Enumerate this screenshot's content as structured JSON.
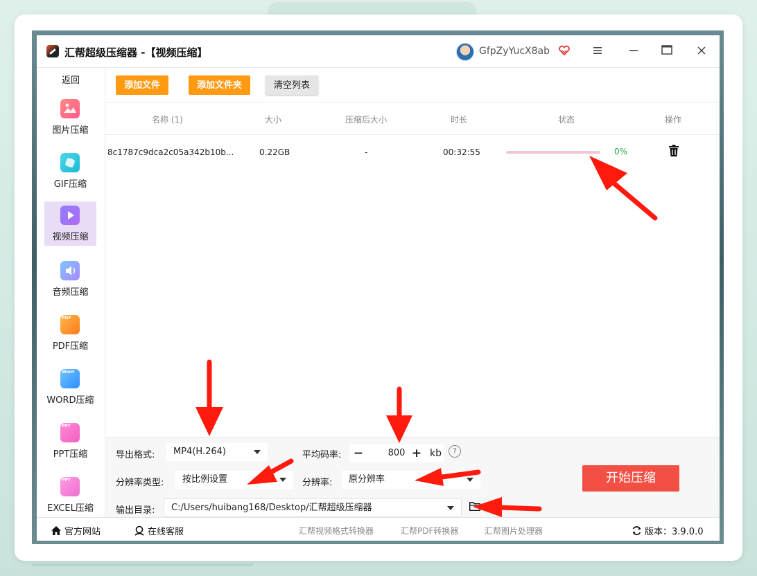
{
  "app": {
    "title": "汇帮超级压缩器  -【视频压缩】",
    "username": "GfpZyYucX8ab"
  },
  "sidebar": {
    "back": "返回",
    "items": [
      {
        "label": "图片压缩",
        "icon": "image-icon"
      },
      {
        "label": "GIF压缩",
        "icon": "gif-icon"
      },
      {
        "label": "视频压缩",
        "icon": "video-icon",
        "active": true
      },
      {
        "label": "音频压缩",
        "icon": "audio-icon"
      },
      {
        "label": "PDF压缩",
        "icon": "pdf-icon",
        "tag": "PDF"
      },
      {
        "label": "WORD压缩",
        "icon": "word-icon",
        "tag": "Word"
      },
      {
        "label": "PPT压缩",
        "icon": "ppt-icon",
        "tag": "PPT"
      },
      {
        "label": "EXCEL压缩",
        "icon": "excel-icon",
        "tag": "PPT"
      }
    ]
  },
  "toolbar": {
    "add_file": "添加文件",
    "add_folder": "添加文件夹",
    "clear_list": "清空列表"
  },
  "table": {
    "headers": {
      "name": "名称 (1)",
      "size": "大小",
      "compressed_size": "压缩后大小",
      "duration": "时长",
      "status": "状态",
      "action": "操作"
    },
    "rows": [
      {
        "name": "8c1787c9dca2c05a342b10b...",
        "size": "0.22GB",
        "compressed_size": "-",
        "duration": "00:32:55",
        "progress": 0,
        "progress_text": "0%"
      }
    ]
  },
  "settings": {
    "format_label": "导出格式:",
    "format_value": "MP4(H.264)",
    "bitrate_label": "平均码率:",
    "bitrate_minus": "−",
    "bitrate_value": "800",
    "bitrate_plus": "+",
    "bitrate_unit": "kb",
    "help": "?",
    "res_type_label": "分辨率类型:",
    "res_type_value": "按比例设置",
    "res_label": "分辨率:",
    "res_value": "原分辨率",
    "output_label": "输出目录:",
    "output_value": "C:/Users/huibang168/Desktop/汇帮超级压缩器",
    "start_button": "开始压缩"
  },
  "footer": {
    "website": "官方网站",
    "support": "在线客服",
    "link1": "汇帮视频格式转换器",
    "link2": "汇帮PDF转换器",
    "link3": "汇帮图片处理器",
    "version": "版本：3.9.0.0"
  },
  "colors": {
    "accent_orange": "#ff9a12",
    "start_red": "#f25044",
    "active_side": "#e8dcf6",
    "progress_done": "#27a844",
    "arrow_red": "#ff1a0d"
  }
}
